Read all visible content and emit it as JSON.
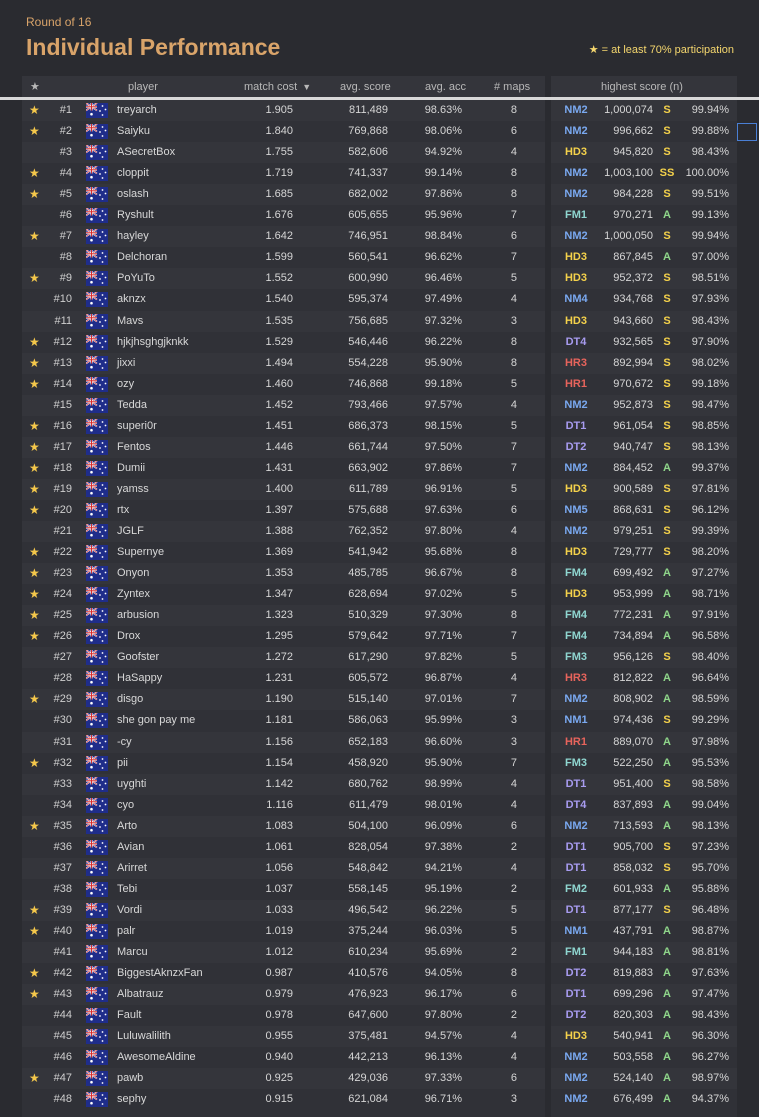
{
  "header": {
    "round": "Round of 16",
    "title": "Individual Performance",
    "note": "★ = at least 70% participation"
  },
  "columns": {
    "star": "★",
    "player": "player",
    "match_cost": "match cost",
    "sort_icon": "▼",
    "avg_score": "avg. score",
    "avg_acc": "avg. acc",
    "maps": "# maps",
    "highest_score": "highest score (n)"
  },
  "colors": {
    "accent": "#d9a46a",
    "star": "#f5c84b",
    "NM": "#7aa9f0",
    "HD": "#f5d24b",
    "FM": "#8fd6d0",
    "DT": "#a89cf0",
    "HR": "#e8645c",
    "grade_S": "#f5d24b",
    "grade_A": "#8fd68a",
    "grade_SS": "#f5d24b",
    "grade_S_white": "#ffffff"
  },
  "rows": [
    {
      "star": "★",
      "rank": "#1",
      "player": "treyarch",
      "cost": "1.905",
      "score": "811,489",
      "acc": "98.63%",
      "maps": "8",
      "mod": "NM2",
      "hs": "1,000,074",
      "grade": "S",
      "hacc": "99.94%"
    },
    {
      "star": "★",
      "rank": "#2",
      "player": "Saiyku",
      "cost": "1.840",
      "score": "769,868",
      "acc": "98.06%",
      "maps": "6",
      "mod": "NM2",
      "hs": "996,662",
      "grade": "S",
      "hacc": "99.88%"
    },
    {
      "star": "",
      "rank": "#3",
      "player": "ASecretBox",
      "cost": "1.755",
      "score": "582,606",
      "acc": "94.92%",
      "maps": "4",
      "mod": "HD3",
      "hs": "945,820",
      "grade": "S",
      "hacc": "98.43%"
    },
    {
      "star": "★",
      "rank": "#4",
      "player": "cloppit",
      "cost": "1.719",
      "score": "741,337",
      "acc": "99.14%",
      "maps": "8",
      "mod": "NM2",
      "hs": "1,003,100",
      "grade": "SS",
      "hacc": "100.00%"
    },
    {
      "star": "★",
      "rank": "#5",
      "player": "oslash",
      "cost": "1.685",
      "score": "682,002",
      "acc": "97.86%",
      "maps": "8",
      "mod": "NM2",
      "hs": "984,228",
      "grade": "S",
      "hacc": "99.51%"
    },
    {
      "star": "",
      "rank": "#6",
      "player": "Ryshult",
      "cost": "1.676",
      "score": "605,655",
      "acc": "95.96%",
      "maps": "7",
      "mod": "FM1",
      "hs": "970,271",
      "grade": "A",
      "hacc": "99.13%"
    },
    {
      "star": "★",
      "rank": "#7",
      "player": "hayley",
      "cost": "1.642",
      "score": "746,951",
      "acc": "98.84%",
      "maps": "6",
      "mod": "NM2",
      "hs": "1,000,050",
      "grade": "S",
      "hacc": "99.94%"
    },
    {
      "star": "",
      "rank": "#8",
      "player": "Delchoran",
      "cost": "1.599",
      "score": "560,541",
      "acc": "96.62%",
      "maps": "7",
      "mod": "HD3",
      "hs": "867,845",
      "grade": "A",
      "hacc": "97.00%"
    },
    {
      "star": "★",
      "rank": "#9",
      "player": "PoYuTo",
      "cost": "1.552",
      "score": "600,990",
      "acc": "96.46%",
      "maps": "5",
      "mod": "HD3",
      "hs": "952,372",
      "grade": "S",
      "hacc": "98.51%"
    },
    {
      "star": "",
      "rank": "#10",
      "player": "aknzx",
      "cost": "1.540",
      "score": "595,374",
      "acc": "97.49%",
      "maps": "4",
      "mod": "NM4",
      "hs": "934,768",
      "grade": "S",
      "hacc": "97.93%"
    },
    {
      "star": "",
      "rank": "#11",
      "player": "Mavs",
      "cost": "1.535",
      "score": "756,685",
      "acc": "97.32%",
      "maps": "3",
      "mod": "HD3",
      "hs": "943,660",
      "grade": "S",
      "hacc": "98.43%"
    },
    {
      "star": "★",
      "rank": "#12",
      "player": "hjkjhsghgjknkk",
      "cost": "1.529",
      "score": "546,446",
      "acc": "96.22%",
      "maps": "8",
      "mod": "DT4",
      "hs": "932,565",
      "grade": "S",
      "hacc": "97.90%"
    },
    {
      "star": "★",
      "rank": "#13",
      "player": "jixxi",
      "cost": "1.494",
      "score": "554,228",
      "acc": "95.90%",
      "maps": "8",
      "mod": "HR3",
      "hs": "892,994",
      "grade": "S",
      "hacc": "98.02%"
    },
    {
      "star": "★",
      "rank": "#14",
      "player": "ozy",
      "cost": "1.460",
      "score": "746,868",
      "acc": "99.18%",
      "maps": "5",
      "mod": "HR1",
      "hs": "970,672",
      "grade": "S",
      "hacc": "99.18%"
    },
    {
      "star": "",
      "rank": "#15",
      "player": "Tedda",
      "cost": "1.452",
      "score": "793,466",
      "acc": "97.57%",
      "maps": "4",
      "mod": "NM2",
      "hs": "952,873",
      "grade": "S",
      "hacc": "98.47%"
    },
    {
      "star": "★",
      "rank": "#16",
      "player": "superi0r",
      "cost": "1.451",
      "score": "686,373",
      "acc": "98.15%",
      "maps": "5",
      "mod": "DT1",
      "hs": "961,054",
      "grade": "S",
      "hacc": "98.85%"
    },
    {
      "star": "★",
      "rank": "#17",
      "player": "Fentos",
      "cost": "1.446",
      "score": "661,744",
      "acc": "97.50%",
      "maps": "7",
      "mod": "DT2",
      "hs": "940,747",
      "grade": "S",
      "hacc": "98.13%"
    },
    {
      "star": "★",
      "rank": "#18",
      "player": "Dumii",
      "cost": "1.431",
      "score": "663,902",
      "acc": "97.86%",
      "maps": "7",
      "mod": "NM2",
      "hs": "884,452",
      "grade": "A",
      "hacc": "99.37%"
    },
    {
      "star": "★",
      "rank": "#19",
      "player": "yamss",
      "cost": "1.400",
      "score": "611,789",
      "acc": "96.91%",
      "maps": "5",
      "mod": "HD3",
      "hs": "900,589",
      "grade": "S",
      "hacc": "97.81%"
    },
    {
      "star": "★",
      "rank": "#20",
      "player": "rtx",
      "cost": "1.397",
      "score": "575,688",
      "acc": "97.63%",
      "maps": "6",
      "mod": "NM5",
      "hs": "868,631",
      "grade": "S",
      "hacc": "96.12%"
    },
    {
      "star": "",
      "rank": "#21",
      "player": "JGLF",
      "cost": "1.388",
      "score": "762,352",
      "acc": "97.80%",
      "maps": "4",
      "mod": "NM2",
      "hs": "979,251",
      "grade": "S",
      "hacc": "99.39%"
    },
    {
      "star": "★",
      "rank": "#22",
      "player": "Supernye",
      "cost": "1.369",
      "score": "541,942",
      "acc": "95.68%",
      "maps": "8",
      "mod": "HD3",
      "hs": "729,777",
      "grade": "S",
      "hacc": "98.20%"
    },
    {
      "star": "★",
      "rank": "#23",
      "player": "Onyon",
      "cost": "1.353",
      "score": "485,785",
      "acc": "96.67%",
      "maps": "8",
      "mod": "FM4",
      "hs": "699,492",
      "grade": "A",
      "hacc": "97.27%"
    },
    {
      "star": "★",
      "rank": "#24",
      "player": "Zyntex",
      "cost": "1.347",
      "score": "628,694",
      "acc": "97.02%",
      "maps": "5",
      "mod": "HD3",
      "hs": "953,999",
      "grade": "A",
      "hacc": "98.71%"
    },
    {
      "star": "★",
      "rank": "#25",
      "player": "arbusion",
      "cost": "1.323",
      "score": "510,329",
      "acc": "97.30%",
      "maps": "8",
      "mod": "FM4",
      "hs": "772,231",
      "grade": "A",
      "hacc": "97.91%"
    },
    {
      "star": "★",
      "rank": "#26",
      "player": "Drox",
      "cost": "1.295",
      "score": "579,642",
      "acc": "97.71%",
      "maps": "7",
      "mod": "FM4",
      "hs": "734,894",
      "grade": "A",
      "hacc": "96.58%"
    },
    {
      "star": "",
      "rank": "#27",
      "player": "Goofster",
      "cost": "1.272",
      "score": "617,290",
      "acc": "97.82%",
      "maps": "5",
      "mod": "FM3",
      "hs": "956,126",
      "grade": "S",
      "hacc": "98.40%"
    },
    {
      "star": "",
      "rank": "#28",
      "player": "HaSappy",
      "cost": "1.231",
      "score": "605,572",
      "acc": "96.87%",
      "maps": "4",
      "mod": "HR3",
      "hs": "812,822",
      "grade": "A",
      "hacc": "96.64%"
    },
    {
      "star": "★",
      "rank": "#29",
      "player": "disgo",
      "cost": "1.190",
      "score": "515,140",
      "acc": "97.01%",
      "maps": "7",
      "mod": "NM2",
      "hs": "808,902",
      "grade": "A",
      "hacc": "98.59%"
    },
    {
      "star": "",
      "rank": "#30",
      "player": "she gon pay me",
      "cost": "1.181",
      "score": "586,063",
      "acc": "95.99%",
      "maps": "3",
      "mod": "NM1",
      "hs": "974,436",
      "grade": "S",
      "hacc": "99.29%"
    },
    {
      "star": "",
      "rank": "#31",
      "player": "-cy",
      "cost": "1.156",
      "score": "652,183",
      "acc": "96.60%",
      "maps": "3",
      "mod": "HR1",
      "hs": "889,070",
      "grade": "A",
      "hacc": "97.98%"
    },
    {
      "star": "★",
      "rank": "#32",
      "player": "pii",
      "cost": "1.154",
      "score": "458,920",
      "acc": "95.90%",
      "maps": "7",
      "mod": "FM3",
      "hs": "522,250",
      "grade": "A",
      "hacc": "95.53%"
    },
    {
      "star": "",
      "rank": "#33",
      "player": "uyghti",
      "cost": "1.142",
      "score": "680,762",
      "acc": "98.99%",
      "maps": "4",
      "mod": "DT1",
      "hs": "951,400",
      "grade": "S",
      "hacc": "98.58%"
    },
    {
      "star": "",
      "rank": "#34",
      "player": "cyo",
      "cost": "1.116",
      "score": "611,479",
      "acc": "98.01%",
      "maps": "4",
      "mod": "DT4",
      "hs": "837,893",
      "grade": "A",
      "hacc": "99.04%"
    },
    {
      "star": "★",
      "rank": "#35",
      "player": "Arto",
      "cost": "1.083",
      "score": "504,100",
      "acc": "96.09%",
      "maps": "6",
      "mod": "NM2",
      "hs": "713,593",
      "grade": "A",
      "hacc": "98.13%"
    },
    {
      "star": "",
      "rank": "#36",
      "player": "Avian",
      "cost": "1.061",
      "score": "828,054",
      "acc": "97.38%",
      "maps": "2",
      "mod": "DT1",
      "hs": "905,700",
      "grade": "S",
      "hacc": "97.23%"
    },
    {
      "star": "",
      "rank": "#37",
      "player": "Arirret",
      "cost": "1.056",
      "score": "548,842",
      "acc": "94.21%",
      "maps": "4",
      "mod": "DT1",
      "hs": "858,032",
      "grade": "S",
      "hacc": "95.70%"
    },
    {
      "star": "",
      "rank": "#38",
      "player": "Tebi",
      "cost": "1.037",
      "score": "558,145",
      "acc": "95.19%",
      "maps": "2",
      "mod": "FM2",
      "hs": "601,933",
      "grade": "A",
      "hacc": "95.88%"
    },
    {
      "star": "★",
      "rank": "#39",
      "player": "Vordi",
      "cost": "1.033",
      "score": "496,542",
      "acc": "96.22%",
      "maps": "5",
      "mod": "DT1",
      "hs": "877,177",
      "grade": "S",
      "hacc": "96.48%"
    },
    {
      "star": "★",
      "rank": "#40",
      "player": "palr",
      "cost": "1.019",
      "score": "375,244",
      "acc": "96.03%",
      "maps": "5",
      "mod": "NM1",
      "hs": "437,791",
      "grade": "A",
      "hacc": "98.87%"
    },
    {
      "star": "",
      "rank": "#41",
      "player": "Marcu",
      "cost": "1.012",
      "score": "610,234",
      "acc": "95.69%",
      "maps": "2",
      "mod": "FM1",
      "hs": "944,183",
      "grade": "A",
      "hacc": "98.81%"
    },
    {
      "star": "★",
      "rank": "#42",
      "player": "BiggestAknzxFan",
      "cost": "0.987",
      "score": "410,576",
      "acc": "94.05%",
      "maps": "8",
      "mod": "DT2",
      "hs": "819,883",
      "grade": "A",
      "hacc": "97.63%"
    },
    {
      "star": "★",
      "rank": "#43",
      "player": "Albatrauz",
      "cost": "0.979",
      "score": "476,923",
      "acc": "96.17%",
      "maps": "6",
      "mod": "DT1",
      "hs": "699,296",
      "grade": "A",
      "hacc": "97.47%"
    },
    {
      "star": "",
      "rank": "#44",
      "player": "Fault",
      "cost": "0.978",
      "score": "647,600",
      "acc": "97.80%",
      "maps": "2",
      "mod": "DT2",
      "hs": "820,303",
      "grade": "A",
      "hacc": "98.43%"
    },
    {
      "star": "",
      "rank": "#45",
      "player": "Luluwalilith",
      "cost": "0.955",
      "score": "375,481",
      "acc": "94.57%",
      "maps": "4",
      "mod": "HD3",
      "hs": "540,941",
      "grade": "A",
      "hacc": "96.30%"
    },
    {
      "star": "",
      "rank": "#46",
      "player": "AwesomeAldine",
      "cost": "0.940",
      "score": "442,213",
      "acc": "96.13%",
      "maps": "4",
      "mod": "NM2",
      "hs": "503,558",
      "grade": "A",
      "hacc": "96.27%"
    },
    {
      "star": "★",
      "rank": "#47",
      "player": "pawb",
      "cost": "0.925",
      "score": "429,036",
      "acc": "97.33%",
      "maps": "6",
      "mod": "NM2",
      "hs": "524,140",
      "grade": "A",
      "hacc": "98.97%"
    },
    {
      "star": "",
      "rank": "#48",
      "player": "sephy",
      "cost": "0.915",
      "score": "621,084",
      "acc": "96.71%",
      "maps": "3",
      "mod": "NM2",
      "hs": "676,499",
      "grade": "A",
      "hacc": "94.37%"
    }
  ]
}
